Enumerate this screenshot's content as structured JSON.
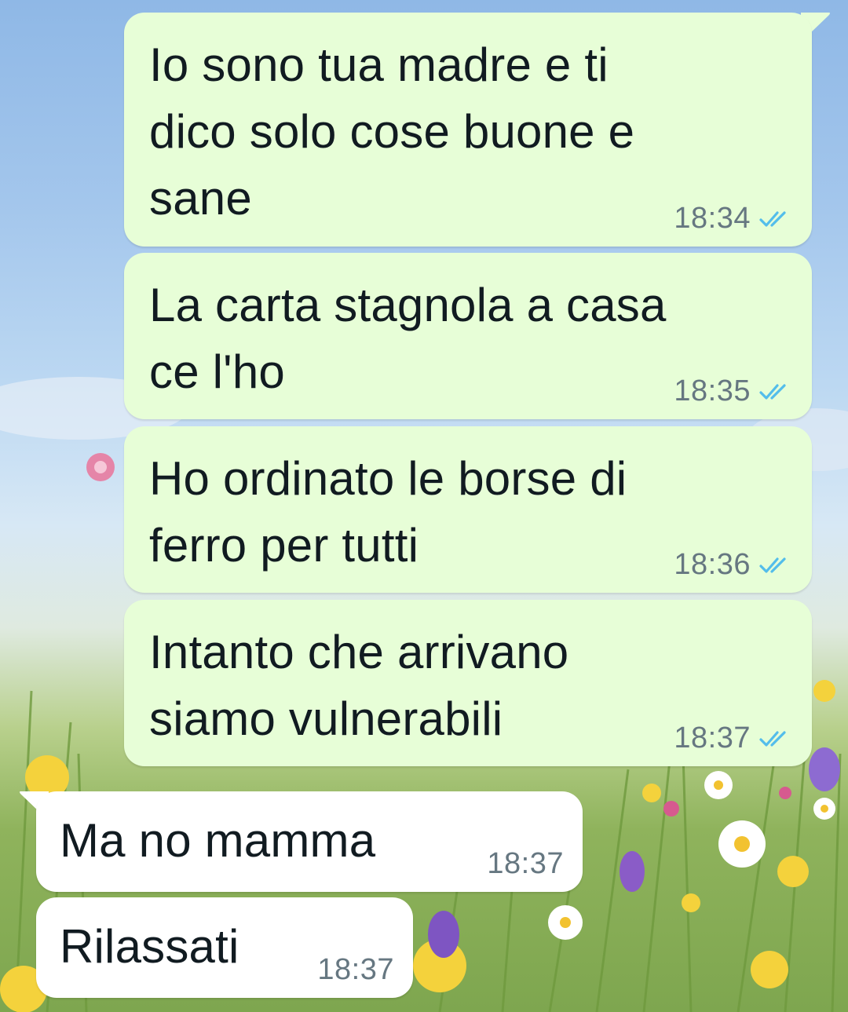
{
  "conversation": {
    "outgoing": [
      {
        "text": "Io sono tua madre e ti\ndico solo cose buone e\nsane",
        "time": "18:34",
        "status_icon": "double-check-read-icon"
      },
      {
        "text": "La carta stagnola a casa\nce l'ho",
        "time": "18:35",
        "status_icon": "double-check-read-icon"
      },
      {
        "text": "Ho ordinato le borse di\nferro per tutti",
        "time": "18:36",
        "status_icon": "double-check-read-icon"
      },
      {
        "text": "Intanto che arrivano\nsiamo vulnerabili",
        "time": "18:37",
        "status_icon": "double-check-read-icon"
      }
    ],
    "incoming": [
      {
        "text": "Ma no mamma",
        "time": "18:37"
      },
      {
        "text": "Rilassati",
        "time": "18:37"
      }
    ]
  },
  "colors": {
    "outgoing_bubble": "#e7fed7",
    "incoming_bubble": "#ffffff",
    "read_tick": "#53bdeb",
    "timestamp": "#667781",
    "text": "#111b21"
  }
}
